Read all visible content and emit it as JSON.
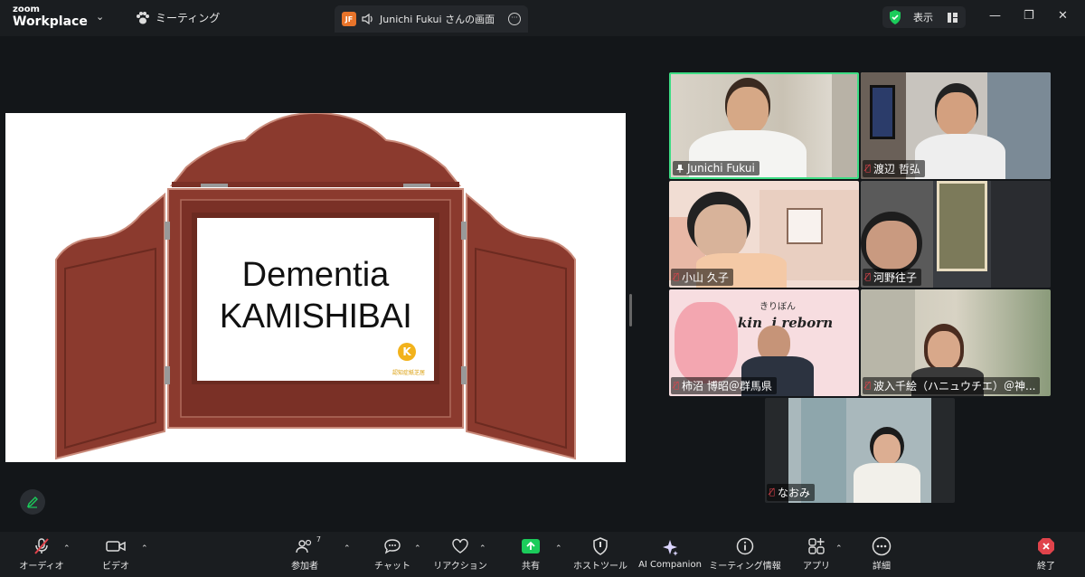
{
  "app": {
    "brand_small": "zoom",
    "brand_large": "Workplace",
    "meeting_menu": "ミーティング"
  },
  "share_tab": {
    "initials": "JF",
    "title": "Junichi Fukui さんの画面"
  },
  "view_button": {
    "label": "表示"
  },
  "slide": {
    "line1": "Dementia",
    "line2": "KAMISHIBAI",
    "logo_text": "認知症紙芝居"
  },
  "participants": [
    {
      "name": "Junichi Fukui",
      "muted": false,
      "active": true
    },
    {
      "name": "渡辺 哲弘",
      "muted": true
    },
    {
      "name": "小山 久子",
      "muted": true
    },
    {
      "name": "河野往子",
      "muted": true
    },
    {
      "name": "柿沼 博昭＠群馬県",
      "muted": true,
      "bg_text": "kin  i reborn",
      "bg_top": "きりぼん"
    },
    {
      "name": "波入千絵（ハニュウチエ）＠神...",
      "muted": true
    },
    {
      "name": "なおみ",
      "muted": true
    }
  ],
  "toolbar": {
    "audio": "オーディオ",
    "video": "ビデオ",
    "participants": "参加者",
    "participants_count": "7",
    "chat": "チャット",
    "reactions": "リアクション",
    "share": "共有",
    "host_tools": "ホストツール",
    "ai_companion": "AI Companion",
    "meeting_info": "ミーティング情報",
    "apps": "アプリ",
    "more": "詳細",
    "end": "終了"
  },
  "colors": {
    "share_green": "#1bcc5b",
    "end_red": "#e0434b",
    "active_speaker": "#3ddc84",
    "kamishibai_wood": "#8b3a2e"
  }
}
